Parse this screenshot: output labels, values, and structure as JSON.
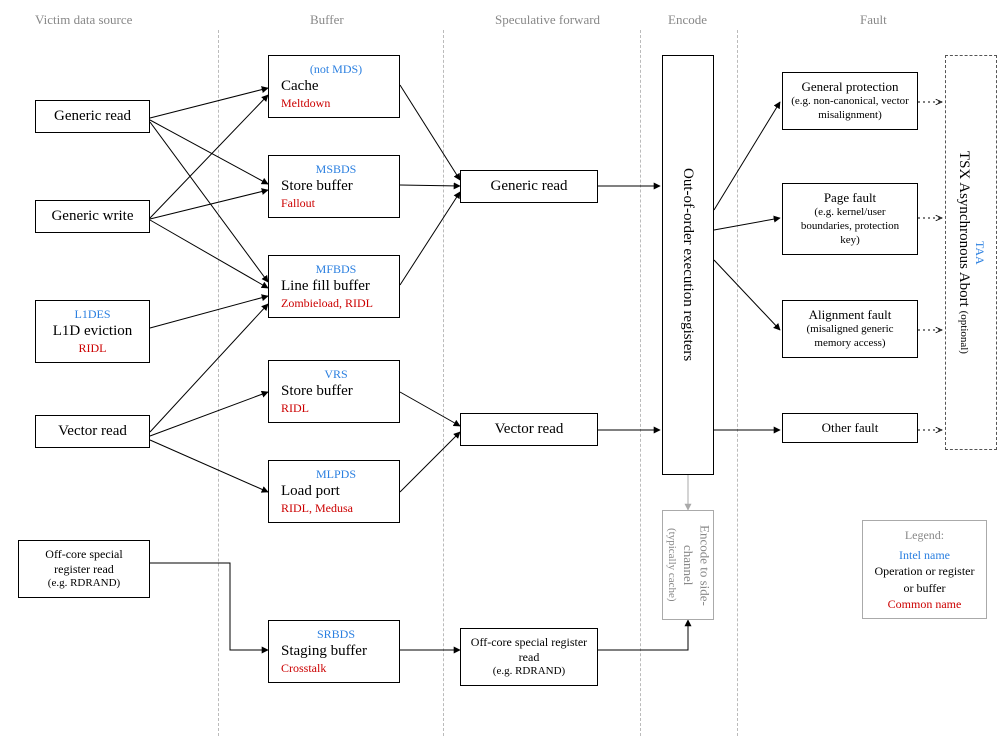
{
  "columns": {
    "victim": "Victim data source",
    "buffer": "Buffer",
    "spec": "Speculative forward",
    "encode": "Encode",
    "fault": "Fault"
  },
  "victim": {
    "generic_read": "Generic read",
    "generic_write": "Generic write",
    "l1d": {
      "intel": "L1DES",
      "main": "L1D eviction",
      "common": "RIDL"
    },
    "vector_read": "Vector read",
    "offcore": {
      "main": "Off-core special register read",
      "sub": "(e.g. RDRAND)"
    }
  },
  "buffer": {
    "cache": {
      "intel": "(not MDS)",
      "main": "Cache",
      "common": "Meltdown"
    },
    "store1": {
      "intel": "MSBDS",
      "main": "Store buffer",
      "common": "Fallout"
    },
    "lfb": {
      "intel": "MFBDS",
      "main": "Line fill buffer",
      "common": "Zombieload, RIDL"
    },
    "store2": {
      "intel": "VRS",
      "main": "Store buffer",
      "common": "RIDL"
    },
    "load": {
      "intel": "MLPDS",
      "main": "Load port",
      "common": "RIDL, Medusa"
    },
    "staging": {
      "intel": "SRBDS",
      "main": "Staging buffer",
      "common": "Crosstalk"
    }
  },
  "spec": {
    "generic_read": "Generic read",
    "vector_read": "Vector read",
    "offcore": {
      "main": "Off-core special register read",
      "sub": "(e.g. RDRAND)"
    }
  },
  "encode": {
    "ooo": "Out-of-order execution registers",
    "side": {
      "main": "Encode to side-channel",
      "sub": "(typically cache)"
    }
  },
  "fault": {
    "gp": {
      "main": "General protection",
      "sub": "(e.g. non-canonical, vector misalignment)"
    },
    "pf": {
      "main": "Page fault",
      "sub": "(e.g. kernel/user boundaries, protection key)"
    },
    "af": {
      "main": "Alignment fault",
      "sub": "(misaligned generic memory access)"
    },
    "other": "Other fault"
  },
  "tsx": {
    "intel": "TAA",
    "main": "TSX Asynchronous Abort",
    "sub": "(optional)"
  },
  "legend": {
    "title": "Legend:",
    "intel": "Intel name",
    "op": "Operation or register or buffer",
    "common": "Common name"
  }
}
